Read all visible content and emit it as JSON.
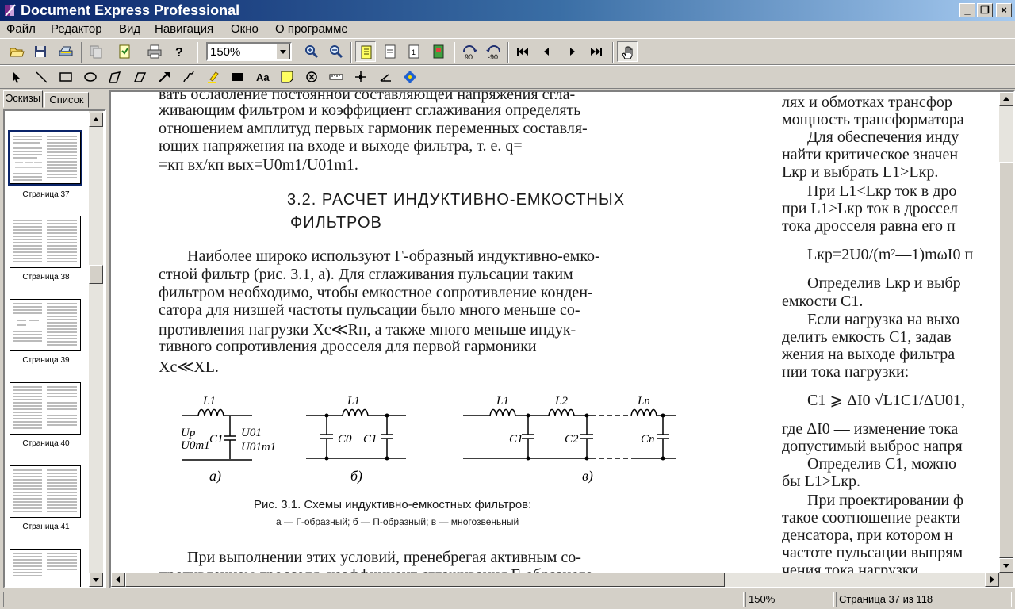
{
  "window": {
    "title": "Document Express Professional"
  },
  "menu": [
    "Файл",
    "Редактор",
    "Вид",
    "Навигация",
    "Окно",
    "О программе"
  ],
  "toolbar": {
    "zoom_value": "150%"
  },
  "tabs": {
    "thumbnails": "Эскизы",
    "list": "Список"
  },
  "thumbnails": [
    {
      "label": "Страница 37"
    },
    {
      "label": "Страница 38"
    },
    {
      "label": "Страница 39"
    },
    {
      "label": "Страница 40"
    },
    {
      "label": "Страница 41"
    }
  ],
  "doc": {
    "left_lines": [
      "вать ослабление постоянной составляющей напряжения сгла-",
      "живающим фильтром и коэффициент сглаживания определять",
      "отношением амплитуд первых гармоник переменных составля-",
      "ющих напряжения на входе и выходе фильтра, т. е. q=",
      "=кп вх/кп вых=U0m1/U01m1."
    ],
    "heading_line1": "3.2.  РАСЧЕТ   ИНДУКТИВНО-ЕМКОСТНЫХ",
    "heading_line2": "ФИЛЬТРОВ",
    "para_lines": [
      "Наиболее широко используют Г-образный индуктивно-емко-",
      "стной фильтр (рис. 3.1, а). Для сглаживания пульсации таким",
      "фильтром необходимо, чтобы емкостное сопротивление конден-",
      "сатора для низшей частоты пульсации было много меньше со-",
      "противления нагрузки Xc≪Rн, а также много меньше индук-",
      "тивного  сопротивления  дросселя  для  первой  гармоники",
      "Xc≪XL."
    ],
    "figure": {
      "a": {
        "L": "L1",
        "C": "C1",
        "Up": "Up",
        "U0m1": "U0m1",
        "U01": "U01",
        "U01m1": "U01m1",
        "label": "а)"
      },
      "b": {
        "L": "L1",
        "C0": "C0",
        "C1": "C1",
        "label": "б)"
      },
      "c": {
        "L1": "L1",
        "L2": "L2",
        "Ln": "Ln",
        "C1": "C1",
        "C2": "C2",
        "Cn": "Cn",
        "label": "в)"
      }
    },
    "caption": "Рис. 3.1. Схемы индуктивно-емкостных фильтров:",
    "caption_sub": "а — Г-образный;  б — П-образный;  в — многозвеньный",
    "bottom_lines": [
      "При выполнении этих условий, пренебрегая активным со-",
      "противлением дросселя, коэффициент сглаживания Г-образного"
    ],
    "right_lines": [
      "лях и обмотках трансфор",
      "мощность трансформатора",
      "Для обеспечения инду",
      "найти критическое значен",
      "Lкр и выбрать L1>Lкр.",
      "При L1<Lкр ток в дро",
      "при L1>Lкр ток в дроссел",
      "тока дросселя равна его п",
      "Lкр=2U0/(m²—1)mωI0 п",
      "Определив Lкр и выбр",
      "емкости C1.",
      "Если нагрузка на выхо",
      "делить емкость C1, задав",
      "жения на выходе фильтра",
      "нии тока нагрузки:",
      "C1 ⩾ ΔI0 √L1C1/ΔU01,",
      "где ΔI0 — изменение тока",
      "допустимый выброс напря",
      "Определив C1, можно",
      "бы L1>Lкр.",
      "При проектировании ф",
      "такое соотношение реакти",
      "денсатора, при котором н",
      "частоте пульсации выпрям",
      "чения тока нагрузки"
    ]
  },
  "status": {
    "zoom": "150%",
    "page": "Страница 37 из 118"
  }
}
